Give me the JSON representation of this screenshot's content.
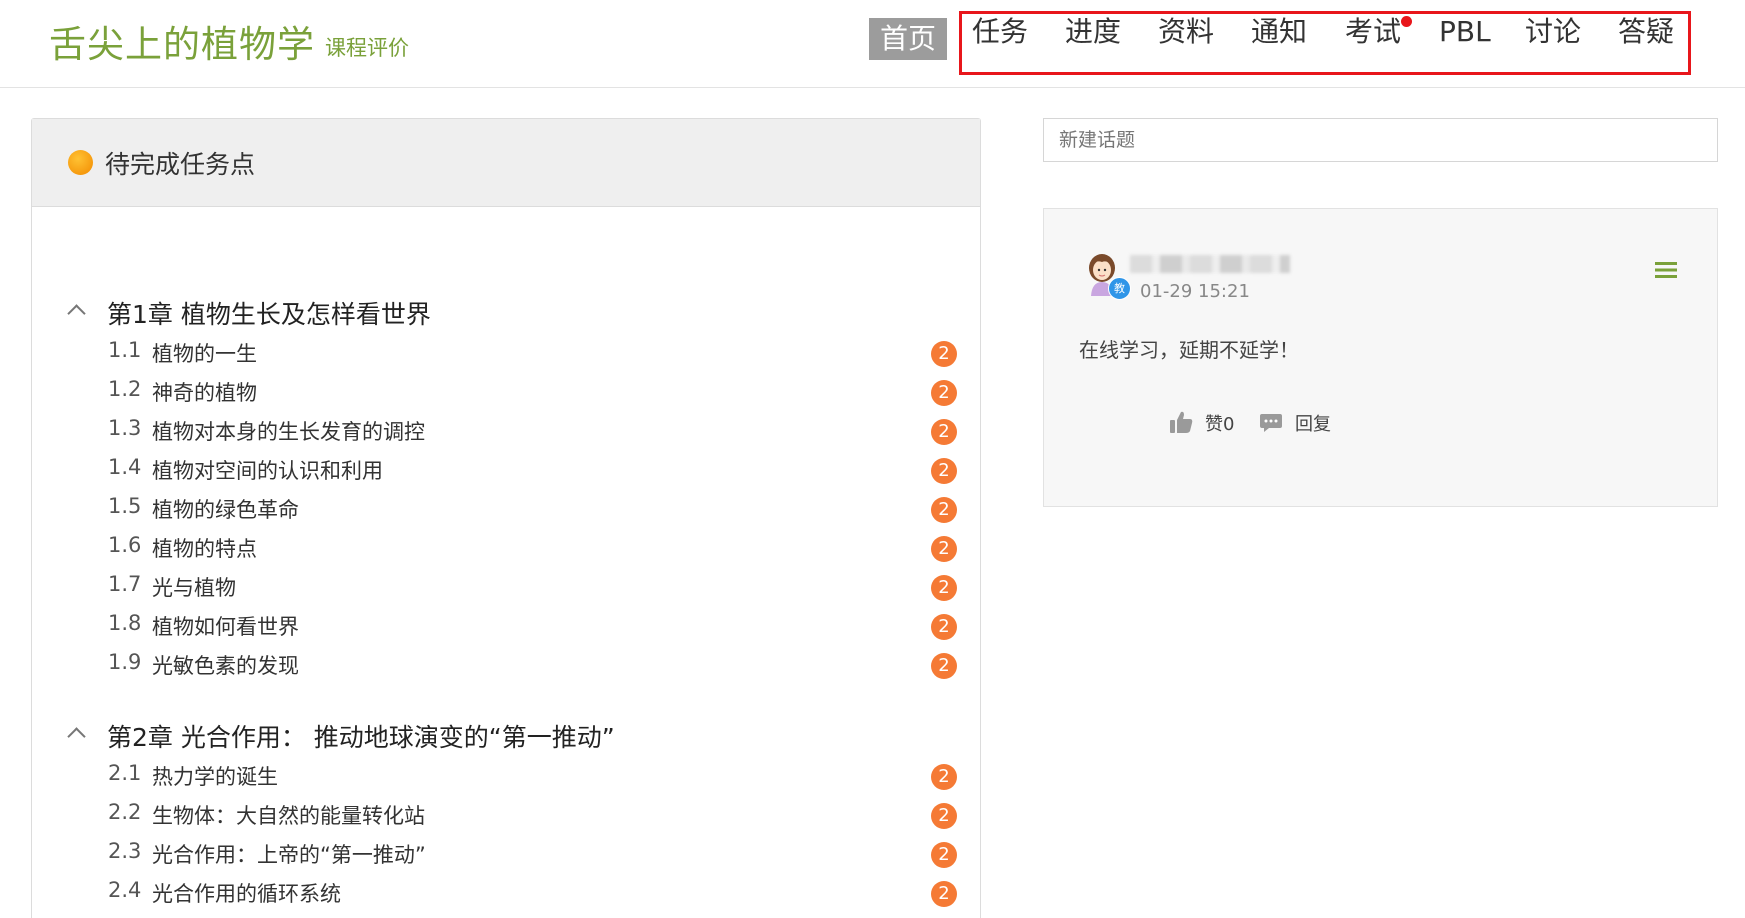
{
  "header": {
    "course_title": "舌尖上的植物学",
    "course_eval": "课程评价",
    "nav_home": "首页",
    "nav_items": [
      {
        "label": "任务"
      },
      {
        "label": "进度"
      },
      {
        "label": "资料"
      },
      {
        "label": "通知"
      },
      {
        "label": "考试"
      },
      {
        "label": "PBL"
      },
      {
        "label": "讨论"
      },
      {
        "label": "答疑"
      }
    ]
  },
  "tasks": {
    "title": "待完成任务点",
    "chapters": [
      {
        "title": "第1章 植物生长及怎样看世界",
        "sections": [
          {
            "num": "1.1",
            "title": "植物的一生",
            "count": "2"
          },
          {
            "num": "1.2",
            "title": "神奇的植物",
            "count": "2"
          },
          {
            "num": "1.3",
            "title": "植物对本身的生长发育的调控",
            "count": "2"
          },
          {
            "num": "1.4",
            "title": "植物对空间的认识和利用",
            "count": "2"
          },
          {
            "num": "1.5",
            "title": "植物的绿色革命",
            "count": "2"
          },
          {
            "num": "1.6",
            "title": "植物的特点",
            "count": "2"
          },
          {
            "num": "1.7",
            "title": "光与植物",
            "count": "2"
          },
          {
            "num": "1.8",
            "title": "植物如何看世界",
            "count": "2"
          },
          {
            "num": "1.9",
            "title": "光敏色素的发现",
            "count": "2"
          }
        ]
      },
      {
        "title": "第2章 光合作用： 推动地球演变的“第一推动”",
        "sections": [
          {
            "num": "2.1",
            "title": "热力学的诞生",
            "count": "2"
          },
          {
            "num": "2.2",
            "title": "生物体：大自然的能量转化站",
            "count": "2"
          },
          {
            "num": "2.3",
            "title": "光合作用：上帝的“第一推动”",
            "count": "2"
          },
          {
            "num": "2.4",
            "title": "光合作用的循环系统",
            "count": "2"
          }
        ]
      }
    ]
  },
  "discussion": {
    "new_topic_placeholder": "新建话题",
    "post": {
      "teacher_badge": "教",
      "time": "01-29 15:21",
      "content": "在线学习，延期不延学！",
      "like_label": "赞0",
      "reply_label": "回复"
    }
  },
  "colors": {
    "brand_green": "#7aa13a",
    "highlight_red": "#e8161b",
    "badge_orange": "#f57a35",
    "home_gray": "#9c9c9c"
  }
}
